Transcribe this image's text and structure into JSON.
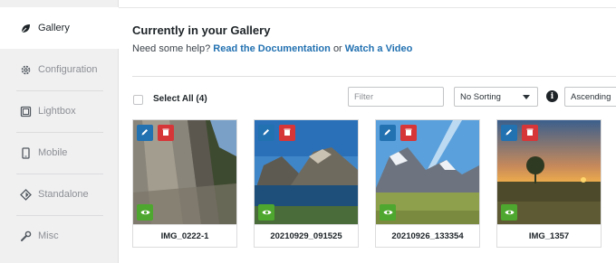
{
  "sidebar": {
    "items": [
      {
        "label": "Gallery",
        "icon": "leaf-icon",
        "active": true
      },
      {
        "label": "Configuration",
        "icon": "gear-icon"
      },
      {
        "label": "Lightbox",
        "icon": "lightbox-icon"
      },
      {
        "label": "Mobile",
        "icon": "mobile-icon"
      },
      {
        "label": "Standalone",
        "icon": "standalone-icon"
      },
      {
        "label": "Misc",
        "icon": "wrench-icon"
      }
    ]
  },
  "header": {
    "title": "Currently in your Gallery",
    "help_prefix": "Need some help?",
    "doc_link": "Read the Documentation",
    "or": "or",
    "video_link": "Watch a Video"
  },
  "toolbar": {
    "select_all": "Select All (4)",
    "filter_placeholder": "Filter",
    "sort_value": "No Sorting",
    "info_glyph": "i",
    "order_value": "Ascending"
  },
  "images": [
    {
      "name": "IMG_0222-1"
    },
    {
      "name": "20210929_091525"
    },
    {
      "name": "20210926_133354"
    },
    {
      "name": "IMG_1357"
    }
  ],
  "colors": {
    "link": "#2271b1",
    "edit": "#2271b1",
    "delete": "#d63638",
    "view": "#4ea72e"
  }
}
